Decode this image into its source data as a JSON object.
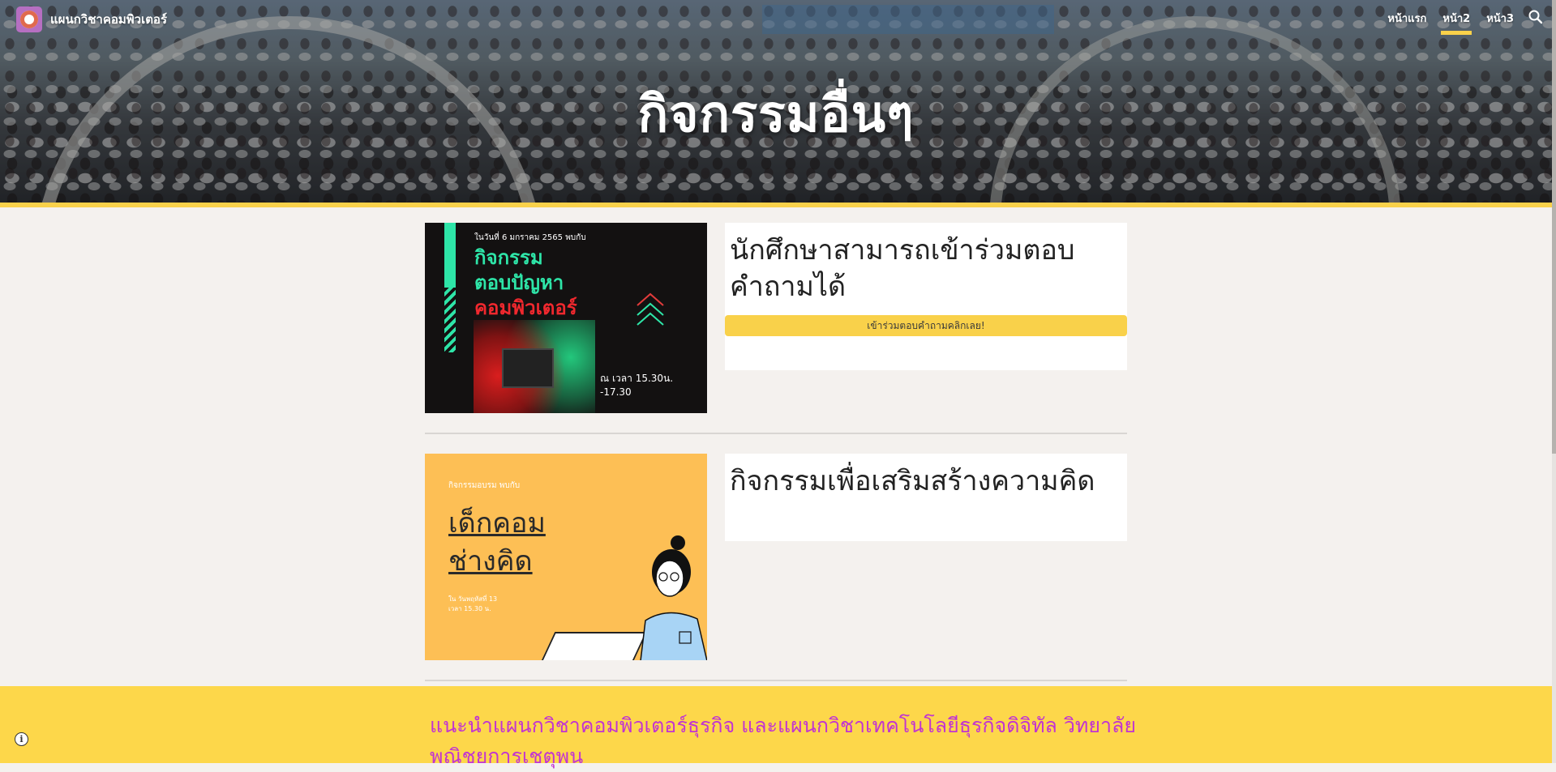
{
  "header": {
    "site_title": "แผนกวิชาคอมพิวเตอร์",
    "nav": [
      {
        "label": "หน้าแรก",
        "active": false
      },
      {
        "label": "หน้า2",
        "active": true
      },
      {
        "label": "หน้า3",
        "active": false
      }
    ],
    "search_icon": "search-icon"
  },
  "hero": {
    "title": "กิจกรรมอื่นๆ"
  },
  "cards": [
    {
      "image": {
        "date_text": "ในวันที่ 6 มกราคม 2565 พบกับ",
        "line1": "กิจกรรม",
        "line2": "ตอบปัญหา",
        "line3": "คอมพิวเตอร์",
        "time_text": "ณ เวลา 15.30น. -17.30"
      },
      "title": "นักศึกษาสามารถเข้าร่วมตอบคำถามได้",
      "button_label": "เข้าร่วมตอบคำถามคลิกเลย!"
    },
    {
      "image": {
        "small_text": "กิจกรรมอบรม พบกับ",
        "big_text": "เด็กคอม\nช่างคิด",
        "when_text": "ใน วันพฤหัสที่ 13\nเวลา 15.30 น."
      },
      "title": "กิจกรรมเพื่อเสริมสร้างความคิด"
    }
  ],
  "footer": {
    "text": "แนะนำแผนกวิชาคอมพิวเตอร์ธุรกิจ และแผนกวิชาเทคโนโลยีธุรกิจดิจิทัล วิทยาลัยพณิชยการเชตุพน"
  },
  "colors": {
    "accent_yellow": "#f9d14a",
    "footer_text": "#c234d1",
    "page_bg": "#f4f1ee"
  }
}
